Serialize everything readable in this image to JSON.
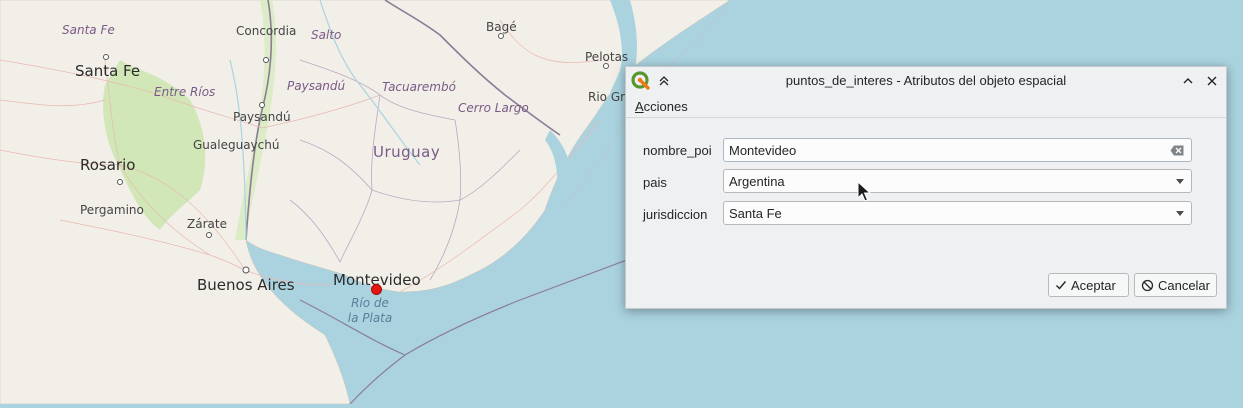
{
  "map": {
    "cities": [
      {
        "id": "santa-fe-small",
        "label": "Santa Fe"
      },
      {
        "id": "santa-fe",
        "label": "Santa Fe"
      },
      {
        "id": "concordia",
        "label": "Concordia"
      },
      {
        "id": "salto",
        "label": "Salto"
      },
      {
        "id": "bage",
        "label": "Bagé"
      },
      {
        "id": "pelotas",
        "label": "Pelotas"
      },
      {
        "id": "rio-gr",
        "label": "Rio Gr"
      },
      {
        "id": "paysandu",
        "label": "Paysandú"
      },
      {
        "id": "gualeguaychu",
        "label": "Gualeguaychú"
      },
      {
        "id": "rosario",
        "label": "Rosario"
      },
      {
        "id": "pergamino",
        "label": "Pergamino"
      },
      {
        "id": "zarate",
        "label": "Zárate"
      },
      {
        "id": "buenos-aires",
        "label": "Buenos Aires"
      },
      {
        "id": "montevideo",
        "label": "Montevideo"
      }
    ],
    "regions": [
      {
        "id": "entre-rios",
        "label": "Entre Ríos"
      },
      {
        "id": "paysandu-region",
        "label": "Paysandú"
      },
      {
        "id": "tacuarembo",
        "label": "Tacuarembó"
      },
      {
        "id": "cerro-largo",
        "label": "Cerro Largo"
      }
    ],
    "country": "Uruguay",
    "water_line1": "Río de",
    "water_line2": "la Plata",
    "marker_color": "#e8140f"
  },
  "dialog": {
    "title": "puntos_de_interes - Atributos del objeto espacial",
    "menu_acciones": "Acciones",
    "fields": [
      {
        "label": "nombre_poi",
        "value": "Montevideo",
        "type": "text"
      },
      {
        "label": "pais",
        "value": "Argentina",
        "type": "combo"
      },
      {
        "label": "jurisdiccion",
        "value": "Santa Fe",
        "type": "combo"
      }
    ],
    "ok_label": "Aceptar",
    "cancel_label": "Cancelar",
    "icons": {
      "app": "qgis-logo-icon",
      "collapse": "double-chevron-up-icon",
      "minimize": "chevron-up-icon",
      "close": "close-icon"
    }
  }
}
